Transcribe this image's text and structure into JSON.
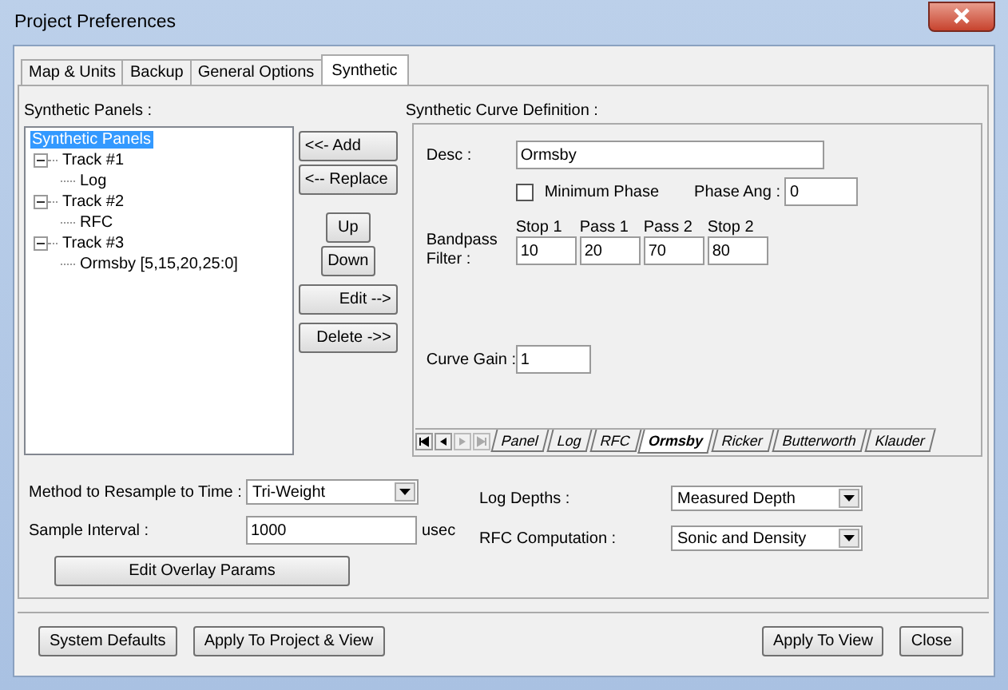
{
  "window": {
    "title": "Project Preferences"
  },
  "tabs": [
    {
      "label": "Map & Units",
      "selected": false
    },
    {
      "label": "Backup",
      "selected": false
    },
    {
      "label": "General Options",
      "selected": false
    },
    {
      "label": "Synthetic",
      "selected": true
    }
  ],
  "synthetic_panels": {
    "label": "Synthetic Panels :",
    "tree": [
      {
        "label": "Synthetic Panels",
        "selected": true,
        "children": [
          {
            "label": "Track #1",
            "selected": false,
            "expanded": true,
            "children": [
              {
                "label": "Log",
                "selected": false
              }
            ]
          },
          {
            "label": "Track #2",
            "selected": false,
            "expanded": true,
            "children": [
              {
                "label": "RFC",
                "selected": false
              }
            ]
          },
          {
            "label": "Track #3",
            "selected": false,
            "expanded": true,
            "children": [
              {
                "label": "Ormsby [5,15,20,25:0]",
                "selected": false
              }
            ]
          }
        ]
      }
    ]
  },
  "panel_buttons": [
    {
      "label": "<<- Add",
      "kind": "wide"
    },
    {
      "label": "<-- Replace",
      "kind": "wide"
    },
    {
      "label": "Up",
      "kind": "narrow"
    },
    {
      "label": "Down",
      "kind": "narrow"
    },
    {
      "label": "Edit -->",
      "kind": "right"
    },
    {
      "label": "Delete ->>",
      "kind": "right"
    }
  ],
  "curve_definition": {
    "label": "Synthetic Curve Definition :",
    "desc": {
      "label": "Desc :",
      "value": "Ormsby"
    },
    "minimum_phase": {
      "label": "Minimum Phase",
      "checked": false
    },
    "phase_ang": {
      "label": "Phase Ang :",
      "value": "0"
    },
    "bandpass": {
      "label": "Bandpass Filter :",
      "stops": [
        {
          "label": "Stop 1",
          "value": "10"
        },
        {
          "label": "Pass 1",
          "value": "20"
        },
        {
          "label": "Pass 2",
          "value": "70"
        },
        {
          "label": "Stop 2",
          "value": "80"
        }
      ]
    },
    "curve_gain": {
      "label": "Curve Gain :",
      "value": "1"
    },
    "tabs": [
      {
        "label": "Panel",
        "selected": false
      },
      {
        "label": "Log",
        "selected": false
      },
      {
        "label": "RFC",
        "selected": false
      },
      {
        "label": "Ormsby",
        "selected": true
      },
      {
        "label": "Ricker",
        "selected": false
      },
      {
        "label": "Butterworth",
        "selected": false
      },
      {
        "label": "Klauder",
        "selected": false
      }
    ]
  },
  "resample": {
    "label": "Method to Resample to Time :",
    "value": "Tri-Weight"
  },
  "sample_interval": {
    "label": "Sample Interval :",
    "value": "1000",
    "unit": "usec"
  },
  "edit_overlay_button": "Edit Overlay Params",
  "log_depths": {
    "label": "Log Depths :",
    "value": "Measured Depth"
  },
  "rfc_computation": {
    "label": "RFC Computation :",
    "value": "Sonic and Density"
  },
  "footer_left_buttons": [
    "System Defaults",
    "Apply To Project & View"
  ],
  "footer_right_buttons": [
    "Apply To View",
    "Close"
  ]
}
